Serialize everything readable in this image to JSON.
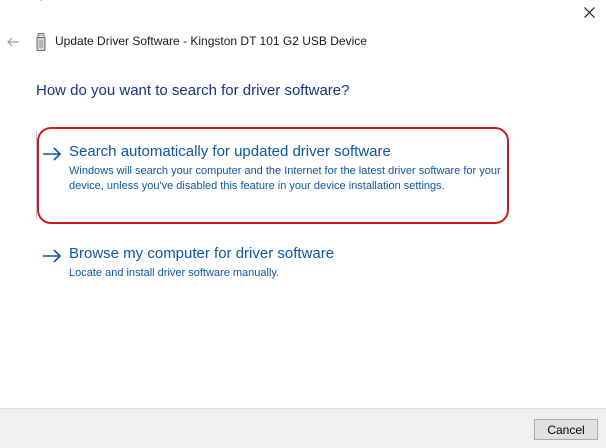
{
  "window": {
    "close_label": "✕"
  },
  "header": {
    "title": "Update Driver Software - Kingston DT 101 G2 USB Device",
    "back_icon": "back-arrow-icon",
    "device_icon": "usb-drive-icon"
  },
  "question": "How do you want to search for driver software?",
  "options": [
    {
      "title": "Search automatically for updated driver software",
      "description": "Windows will search your computer and the Internet for the latest driver software for your device, unless you've disabled this feature in your device installation settings."
    },
    {
      "title": "Browse my computer for driver software",
      "description": "Locate and install driver software manually."
    }
  ],
  "footer": {
    "cancel_label": "Cancel"
  },
  "colors": {
    "link_blue": "#0b57a4",
    "heading_blue": "#16337f",
    "highlight_red": "#d01a1a"
  }
}
